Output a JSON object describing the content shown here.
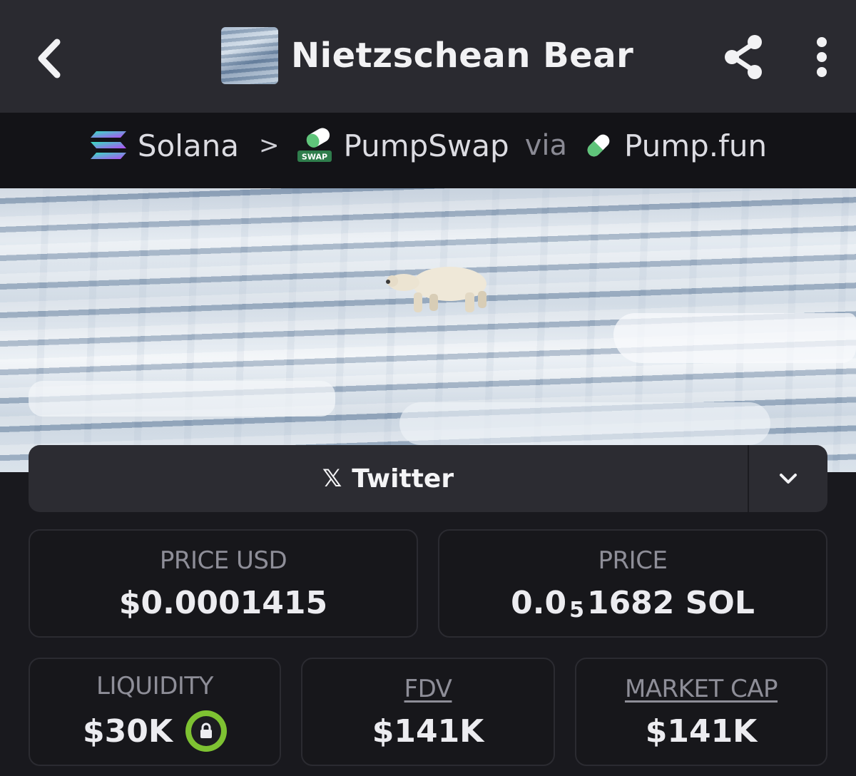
{
  "header": {
    "title": "Nietzschean Bear",
    "back_icon": "chevron-left-icon",
    "share_icon": "share-icon",
    "more_icon": "more-vertical-icon"
  },
  "breadcrumb": {
    "chain": "Solana",
    "separator": ">",
    "dex": "PumpSwap",
    "dex_badge": "SWAP",
    "via": "via",
    "launchpad": "Pump.fun"
  },
  "social": {
    "twitter_icon": "x-logo-icon",
    "twitter_label": "Twitter",
    "expand_icon": "chevron-down-icon"
  },
  "stats": {
    "price_usd": {
      "label": "PRICE USD",
      "value": "$0.0001415"
    },
    "price": {
      "label": "PRICE",
      "value_prefix": "0.0",
      "value_sub": "5",
      "value_suffix": "1682 SOL"
    },
    "liquidity": {
      "label": "LIQUIDITY",
      "value": "$30K",
      "lock_icon": "lock-icon"
    },
    "fdv": {
      "label": "FDV",
      "value": "$141K"
    },
    "market_cap": {
      "label": "MARKET CAP",
      "value": "$141K"
    }
  },
  "colors": {
    "accent_green": "#7ec232",
    "background": "#19191e",
    "header": "#2a2a30"
  }
}
